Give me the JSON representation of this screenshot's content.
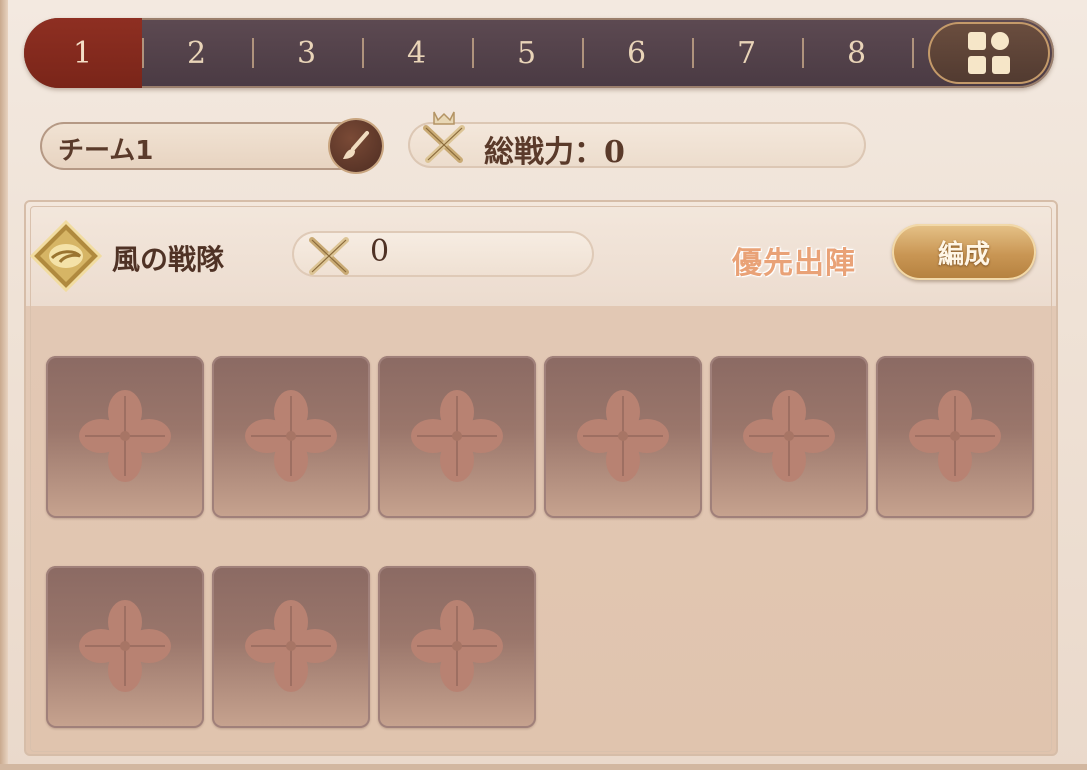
{
  "tabs": [
    {
      "label": "1",
      "active": true
    },
    {
      "label": "2",
      "active": false
    },
    {
      "label": "3",
      "active": false
    },
    {
      "label": "4",
      "active": false
    },
    {
      "label": "5",
      "active": false
    },
    {
      "label": "6",
      "active": false
    },
    {
      "label": "7",
      "active": false
    },
    {
      "label": "8",
      "active": false
    }
  ],
  "grid_button_icon": "grid-menu-icon",
  "team": {
    "name": "チーム1",
    "rename_icon": "brush-icon"
  },
  "total_power": {
    "label": "総戦力：0",
    "icon": "crossed-swords-crown-icon"
  },
  "squad": {
    "emblem_icon": "wind-emblem-icon",
    "name": "風の戦隊",
    "power_value": "0",
    "power_icon": "crossed-swords-icon",
    "priority_label": "優先出陣",
    "edit_button": "編成"
  },
  "slots": {
    "count": 9,
    "empty_icon": "flower-crest-icon"
  },
  "colors": {
    "tab_active": "#8e2f22",
    "tab_bar": "#4a3a43",
    "accent_gold": "#c99654",
    "priority_text": "#e9a277"
  }
}
